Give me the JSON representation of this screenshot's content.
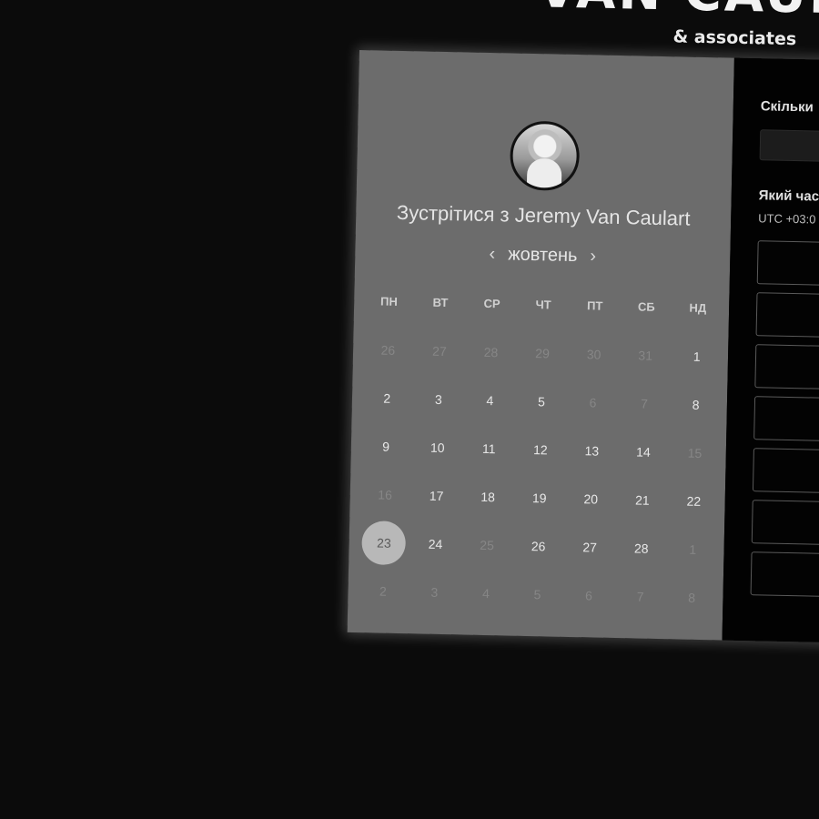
{
  "brand": {
    "name": "VAN CAULART",
    "sub": "& associates"
  },
  "calendar": {
    "heading": "Зустрітися з Jeremy Van Caulart",
    "month": "жовтень",
    "prev": "‹",
    "next": "›",
    "weekdays": [
      "ПН",
      "ВТ",
      "СР",
      "ЧТ",
      "ПТ",
      "СБ",
      "НД"
    ],
    "weeks": [
      [
        {
          "d": "26",
          "m": true
        },
        {
          "d": "27",
          "m": true
        },
        {
          "d": "28",
          "m": true
        },
        {
          "d": "29",
          "m": true
        },
        {
          "d": "30",
          "m": true
        },
        {
          "d": "31",
          "m": true
        },
        {
          "d": "1",
          "m": false
        }
      ],
      [
        {
          "d": "2",
          "m": false
        },
        {
          "d": "3",
          "m": false
        },
        {
          "d": "4",
          "m": false
        },
        {
          "d": "5",
          "m": false
        },
        {
          "d": "6",
          "m": true
        },
        {
          "d": "7",
          "m": true
        },
        {
          "d": "8",
          "m": false
        }
      ],
      [
        {
          "d": "9",
          "m": false
        },
        {
          "d": "10",
          "m": false
        },
        {
          "d": "11",
          "m": false
        },
        {
          "d": "12",
          "m": false
        },
        {
          "d": "13",
          "m": false
        },
        {
          "d": "14",
          "m": false
        },
        {
          "d": "15",
          "m": true
        }
      ],
      [
        {
          "d": "16",
          "m": true
        },
        {
          "d": "17",
          "m": false
        },
        {
          "d": "18",
          "m": false
        },
        {
          "d": "19",
          "m": false
        },
        {
          "d": "20",
          "m": false
        },
        {
          "d": "21",
          "m": false
        },
        {
          "d": "22",
          "m": false
        }
      ],
      [
        {
          "d": "23",
          "m": false,
          "s": true
        },
        {
          "d": "24",
          "m": false
        },
        {
          "d": "25",
          "m": true
        },
        {
          "d": "26",
          "m": false
        },
        {
          "d": "27",
          "m": false
        },
        {
          "d": "28",
          "m": false
        },
        {
          "d": "1",
          "m": true
        }
      ],
      [
        {
          "d": "2",
          "m": true
        },
        {
          "d": "3",
          "m": true
        },
        {
          "d": "4",
          "m": true
        },
        {
          "d": "5",
          "m": true
        },
        {
          "d": "6",
          "m": true
        },
        {
          "d": "7",
          "m": true
        },
        {
          "d": "8",
          "m": true
        }
      ]
    ]
  },
  "panel": {
    "duration_label": "Скільки",
    "time_label": "Який час",
    "timezone": "UTC +03:0"
  }
}
